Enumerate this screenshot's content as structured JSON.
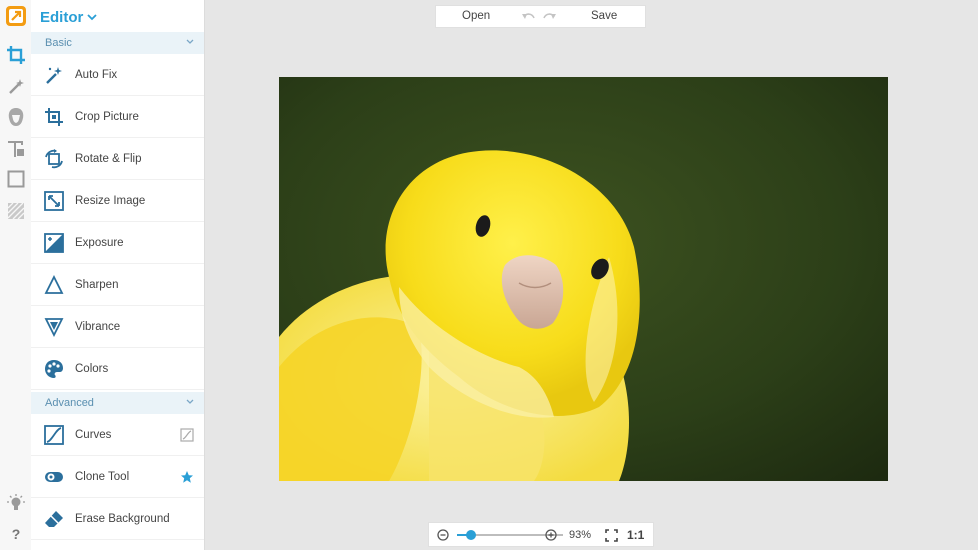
{
  "app": {
    "panel_title": "Editor",
    "accent_color": "#2a9fd6",
    "logo_color": "#f39c12"
  },
  "rail": {
    "icons": [
      "crop-icon",
      "magic-wand-icon",
      "portrait-icon",
      "text-icon",
      "frame-icon",
      "texture-icon",
      "lightbulb-icon",
      "help-icon"
    ],
    "help_label": "?"
  },
  "sections": {
    "basic": "Basic",
    "advanced": "Advanced"
  },
  "basic_items": [
    {
      "label": "Auto Fix",
      "icon": "magic-wand-icon"
    },
    {
      "label": "Crop Picture",
      "icon": "crop-icon"
    },
    {
      "label": "Rotate & Flip",
      "icon": "rotate-icon"
    },
    {
      "label": "Resize Image",
      "icon": "resize-icon"
    },
    {
      "label": "Exposure",
      "icon": "exposure-icon"
    },
    {
      "label": "Sharpen",
      "icon": "triangle-icon"
    },
    {
      "label": "Vibrance",
      "icon": "vibrance-icon"
    },
    {
      "label": "Colors",
      "icon": "palette-icon"
    }
  ],
  "advanced_items": [
    {
      "label": "Curves",
      "icon": "curves-icon",
      "trail": "curves-mini-icon"
    },
    {
      "label": "Clone Tool",
      "icon": "clone-icon",
      "trail": "star-icon"
    },
    {
      "label": "Erase Background",
      "icon": "eraser-icon"
    }
  ],
  "toolbar": {
    "open_label": "Open",
    "save_label": "Save",
    "undo_icon": "undo-icon",
    "redo_icon": "redo-icon"
  },
  "zoom": {
    "percent_label": "93%",
    "level": 0.93,
    "actual_size_label": "1:1"
  }
}
